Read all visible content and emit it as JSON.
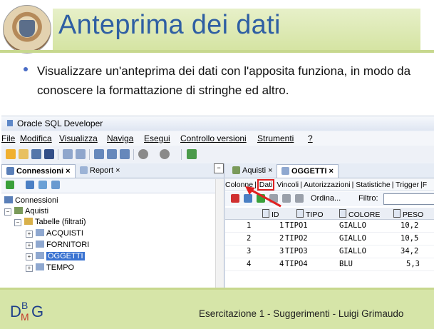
{
  "slide": {
    "title": "Anteprima dei dati",
    "bullet": "Visualizzare un'anteprima dei dati con l'apposita funziona, in modo da conoscere la formattazione di stringhe ed altro.",
    "footer": "Esercitazione 1 - Suggerimenti - Luigi Grimaudo",
    "logo_text": "DBMG"
  },
  "app": {
    "window_title": "Oracle SQL Developer",
    "menu": [
      "File",
      "Modifica",
      "Visualizza",
      "Naviga",
      "Esegui",
      "Controllo versioni",
      "Strumenti",
      "?"
    ]
  },
  "left_panel": {
    "tabs": [
      "Connessioni",
      "Report"
    ],
    "tree": {
      "root": "Connessioni",
      "connection": "Aquisti",
      "folder": "Tabelle (filtrati)",
      "tables": [
        "ACQUISTI",
        "FORNITORI",
        "OGGETTI",
        "TEMPO"
      ],
      "selected": "OGGETTI"
    }
  },
  "right_panel": {
    "tabs": [
      "Aquisti",
      "OGGETTI"
    ],
    "subtabs": [
      "Colonne",
      "Dati",
      "Vincoli",
      "Autorizzazioni",
      "Statistiche",
      "Trigger"
    ],
    "subtabs_trailing": "F",
    "active_subtab": "Dati",
    "sort_label": "Ordina...",
    "filter_label": "Filtro:",
    "grid": {
      "columns": [
        "ID",
        "TIPO",
        "COLORE",
        "PESO"
      ],
      "rows": [
        {
          "n": "1",
          "id": "1",
          "tipo": "TIPO1",
          "colore": "GIALLO",
          "peso": "10,2"
        },
        {
          "n": "2",
          "id": "2",
          "tipo": "TIPO2",
          "colore": "GIALLO",
          "peso": "10,5"
        },
        {
          "n": "3",
          "id": "3",
          "tipo": "TIPO3",
          "colore": "GIALLO",
          "peso": "34,2"
        },
        {
          "n": "4",
          "id": "4",
          "tipo": "TIPO4",
          "colore": "BLU",
          "peso": "5,3"
        }
      ]
    }
  },
  "colors": {
    "title": "#2f5fa3",
    "band": "#d6e5a8",
    "highlight": "#e02020",
    "selection": "#3a73d1"
  }
}
